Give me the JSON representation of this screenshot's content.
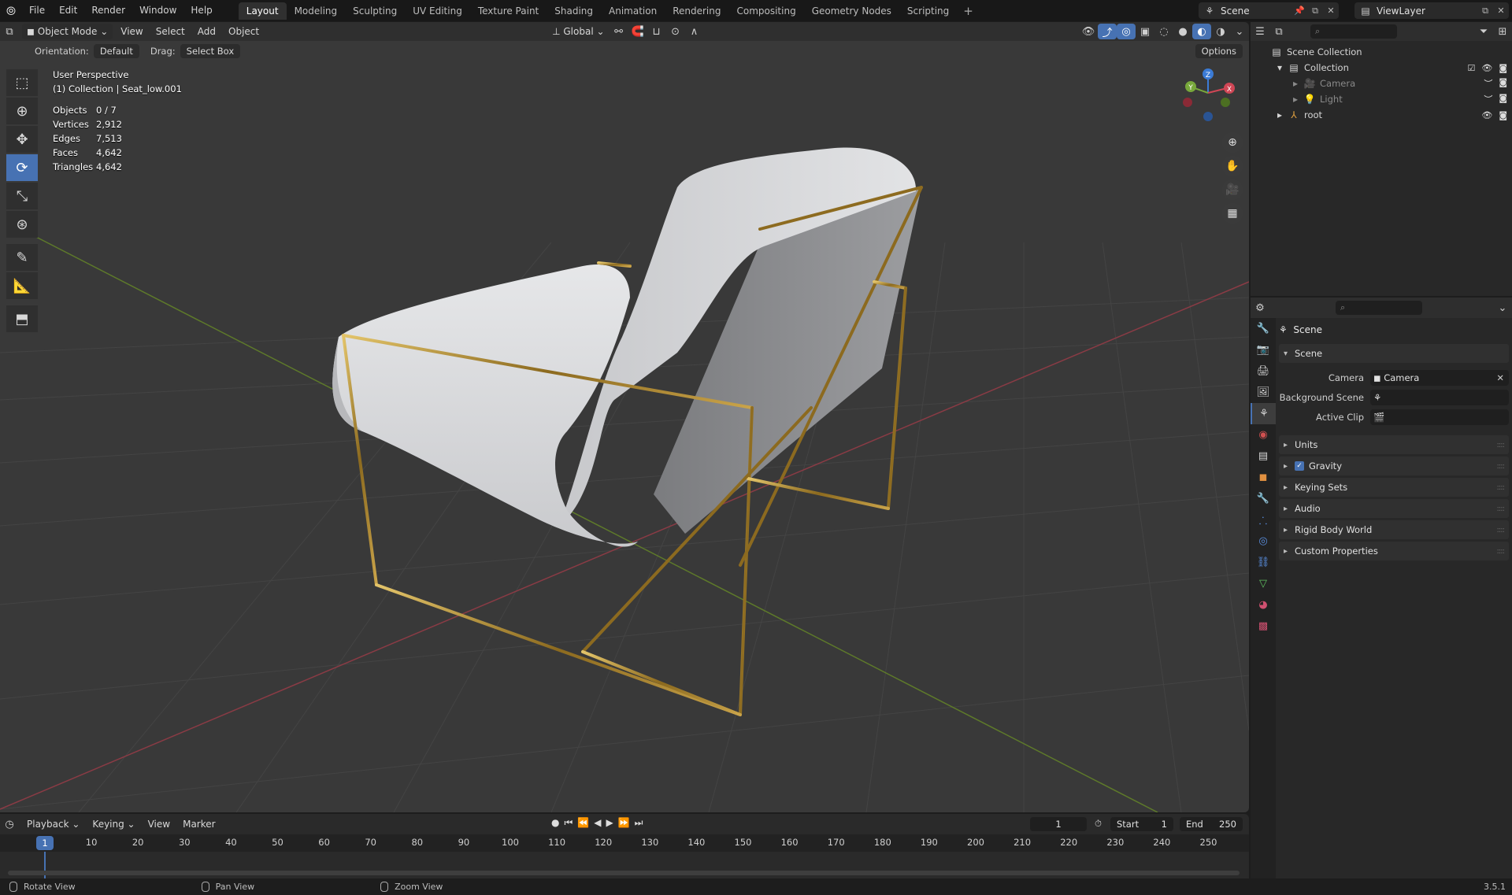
{
  "topbar": {
    "menus": [
      "File",
      "Edit",
      "Render",
      "Window",
      "Help"
    ],
    "workspaces": [
      "Layout",
      "Modeling",
      "Sculpting",
      "UV Editing",
      "Texture Paint",
      "Shading",
      "Animation",
      "Rendering",
      "Compositing",
      "Geometry Nodes",
      "Scripting"
    ],
    "active_workspace": "Layout",
    "scene": "Scene",
    "view_layer": "ViewLayer"
  },
  "viewport": {
    "mode": "Object Mode",
    "menus": [
      "View",
      "Select",
      "Add",
      "Object"
    ],
    "transform_orientation": "Global",
    "orientation_label": "Orientation:",
    "orientation_value": "Default",
    "drag_label": "Drag:",
    "drag_value": "Select Box",
    "options_label": "Options",
    "view_name": "User Perspective",
    "active_info": "(1) Collection | Seat_low.001",
    "stats": [
      {
        "label": "Objects",
        "value": "0 / 7"
      },
      {
        "label": "Vertices",
        "value": "2,912"
      },
      {
        "label": "Edges",
        "value": "7,513"
      },
      {
        "label": "Faces",
        "value": "4,642"
      },
      {
        "label": "Triangles",
        "value": "4,642"
      }
    ],
    "gizmo_axes": {
      "x": "X",
      "y": "Y",
      "z": "Z"
    }
  },
  "outliner": {
    "root": "Scene Collection",
    "items": [
      {
        "name": "Collection",
        "level": 1
      },
      {
        "name": "Camera",
        "level": 2
      },
      {
        "name": "Light",
        "level": 2
      },
      {
        "name": "root",
        "level": 1
      }
    ]
  },
  "properties": {
    "title": "Scene",
    "section": "Scene",
    "fields": [
      {
        "label": "Camera",
        "value": "Camera"
      },
      {
        "label": "Background Scene",
        "value": ""
      },
      {
        "label": "Active Clip",
        "value": ""
      }
    ],
    "panels": [
      "Units",
      "Gravity",
      "Keying Sets",
      "Audio",
      "Rigid Body World",
      "Custom Properties"
    ]
  },
  "timeline": {
    "menus": [
      "Playback",
      "Keying",
      "View",
      "Marker"
    ],
    "current_frame": "1",
    "start_label": "Start",
    "start": "1",
    "end_label": "End",
    "end": "250",
    "ticks": [
      "10",
      "20",
      "30",
      "40",
      "50",
      "60",
      "70",
      "80",
      "90",
      "100",
      "110",
      "120",
      "130",
      "140",
      "150",
      "160",
      "170",
      "180",
      "190",
      "200",
      "210",
      "220",
      "230",
      "240",
      "250"
    ]
  },
  "statusbar": {
    "items": [
      "Rotate View",
      "Pan View",
      "Zoom View"
    ],
    "version": "3.5.1"
  },
  "colors": {
    "accent": "#4772b3",
    "viewport_bg": "#393939",
    "axis_x": "#c8414f",
    "axis_y": "#7aa12b",
    "gold": "#b08a2e",
    "cushion": "#d9dadc"
  }
}
